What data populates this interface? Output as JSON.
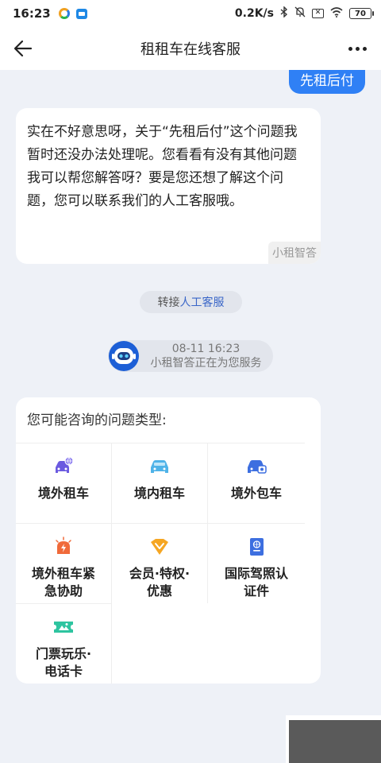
{
  "status_bar": {
    "time": "16:23",
    "net_speed": "0.2K/s",
    "battery": "70"
  },
  "nav": {
    "title": "租租车在线客服"
  },
  "chat": {
    "user_message": "先租后付",
    "bot_reply": "实在不好意思呀，关于“先租后付”这个问题我暂时还没办法处理呢。您看看有没有其他问题我可以帮您解答呀？要是您还想了解这个问题，您可以联系我们的人工客服哦。",
    "bot_name_tag": "小租智答",
    "transfer_prefix": "转接",
    "transfer_link": "人工客服",
    "service_time": "08-11 16:23",
    "service_status": "小租智答正在为您服务"
  },
  "faq": {
    "title": "您可能咨询的问题类型:",
    "items": [
      {
        "label_line1": "境外租车",
        "label_line2": "",
        "icon": "car-globe-icon",
        "color": "#6b5ae0"
      },
      {
        "label_line1": "境内租车",
        "label_line2": "",
        "icon": "car-icon",
        "color": "#4fb3e8"
      },
      {
        "label_line1": "境外包车",
        "label_line2": "",
        "icon": "car-chauffeur-icon",
        "color": "#3d6fe0"
      },
      {
        "label_line1": "境外租车紧",
        "label_line2": "急协助",
        "icon": "emergency-icon",
        "color": "#f06a3a"
      },
      {
        "label_line1": "会员·特权·",
        "label_line2": "优惠",
        "icon": "vip-icon",
        "color": "#f5a623"
      },
      {
        "label_line1": "国际驾照认",
        "label_line2": "证件",
        "icon": "passport-icon",
        "color": "#3d6fe0"
      },
      {
        "label_line1": "门票玩乐·",
        "label_line2": "电话卡",
        "icon": "ticket-icon",
        "color": "#2ec4a0"
      }
    ]
  }
}
